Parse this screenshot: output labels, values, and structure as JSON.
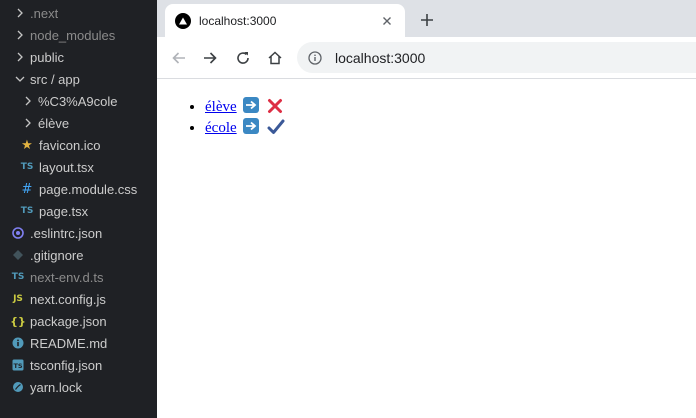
{
  "sidebar": {
    "items": [
      {
        "label": ".next",
        "kind": "folder",
        "expanded": false,
        "dim": true
      },
      {
        "label": "node_modules",
        "kind": "folder",
        "expanded": false,
        "dim": true
      },
      {
        "label": "public",
        "kind": "folder",
        "expanded": false,
        "dim": false
      },
      {
        "label": "src / app",
        "kind": "folder",
        "expanded": true,
        "dim": false
      },
      {
        "label": "%C3%A9cole",
        "kind": "folder",
        "expanded": false,
        "dim": false
      },
      {
        "label": "élève",
        "kind": "folder",
        "expanded": false,
        "dim": false
      },
      {
        "label": "favicon.ico",
        "kind": "file",
        "icon": "star-icon",
        "dim": false
      },
      {
        "label": "layout.tsx",
        "kind": "file",
        "icon": "ts-file-icon",
        "dim": false
      },
      {
        "label": "page.module.css",
        "kind": "file",
        "icon": "css-file-icon",
        "dim": false
      },
      {
        "label": "page.tsx",
        "kind": "file",
        "icon": "ts-file-icon",
        "dim": false
      },
      {
        "label": ".eslintrc.json",
        "kind": "file",
        "icon": "eslint-file-icon",
        "dim": false
      },
      {
        "label": ".gitignore",
        "kind": "file",
        "icon": "git-file-icon",
        "dim": false
      },
      {
        "label": "next-env.d.ts",
        "kind": "file",
        "icon": "ts-file-icon",
        "dim": true
      },
      {
        "label": "next.config.js",
        "kind": "file",
        "icon": "js-file-icon",
        "dim": false
      },
      {
        "label": "package.json",
        "kind": "file",
        "icon": "json-file-icon",
        "dim": false
      },
      {
        "label": "README.md",
        "kind": "file",
        "icon": "info-file-icon",
        "dim": false
      },
      {
        "label": "tsconfig.json",
        "kind": "file",
        "icon": "tsconfig-file-icon",
        "dim": false
      },
      {
        "label": "yarn.lock",
        "kind": "file",
        "icon": "yarn-file-icon",
        "dim": false
      }
    ]
  },
  "browser": {
    "tab": {
      "title": "localhost:3000",
      "favicon": "nextjs-triangle-icon"
    },
    "address": {
      "value": "localhost:3000"
    },
    "content": {
      "links": [
        {
          "text": "élève",
          "arrow": "right-arrow-emoji-icon",
          "status": "cross-mark-icon",
          "status_color": "#dd2e44"
        },
        {
          "text": "école",
          "arrow": "right-arrow-emoji-icon",
          "status": "check-mark-icon",
          "status_color": "#3b5998"
        }
      ]
    }
  },
  "colors": {
    "sidebar_bg": "#1f2125",
    "tabstrip_bg": "#dee1e6",
    "omnibox_bg": "#f1f3f4",
    "link": "#0000ee"
  }
}
